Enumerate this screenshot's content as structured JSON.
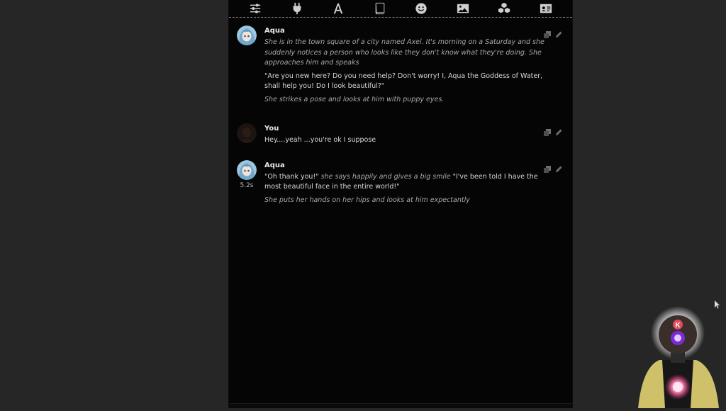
{
  "toolbar": {
    "buttons": [
      {
        "icon": "sliders-icon",
        "name": "settings"
      },
      {
        "icon": "plug-icon",
        "name": "connections"
      },
      {
        "icon": "font-icon",
        "name": "formatting"
      },
      {
        "icon": "book-icon",
        "name": "world-info"
      },
      {
        "icon": "smile-icon",
        "name": "user-settings"
      },
      {
        "icon": "image-icon",
        "name": "backgrounds"
      },
      {
        "icon": "cubes-icon",
        "name": "extensions"
      },
      {
        "icon": "id-card-icon",
        "name": "persona"
      }
    ]
  },
  "messages": [
    {
      "name": "Aqua",
      "narration1": "She is in the town square of a city named Axel. It's morning on a Saturday and she suddenly notices a person who looks like they don't know what they're doing. She approaches him and speaks",
      "speech": "\"Are you new here? Do you need help? Don't worry! I, Aqua the Goddess of Water, shall help you! Do I look beautiful?\"",
      "narration2": "She strikes a pose and looks at him with puppy eyes."
    },
    {
      "name": "You",
      "text": "Hey....yeah ...you're ok I suppose"
    },
    {
      "name": "Aqua",
      "timer": "5.2s",
      "speech_a": "\"Oh thank you!\"",
      "aside": " she says happily and gives a big smile ",
      "speech_b": "\"I've been told I have the most beautiful face in the entire world!\"",
      "narration": "She puts her hands on her hips and looks at him expectantly"
    }
  ],
  "colors": {
    "page_bg": "#262626",
    "chat_bg": "#050505",
    "name": "#e8e8e8",
    "speech": "#d8d8d8",
    "narration": "#a9a9a9"
  },
  "overlay": {
    "streamer_badge": "K"
  }
}
